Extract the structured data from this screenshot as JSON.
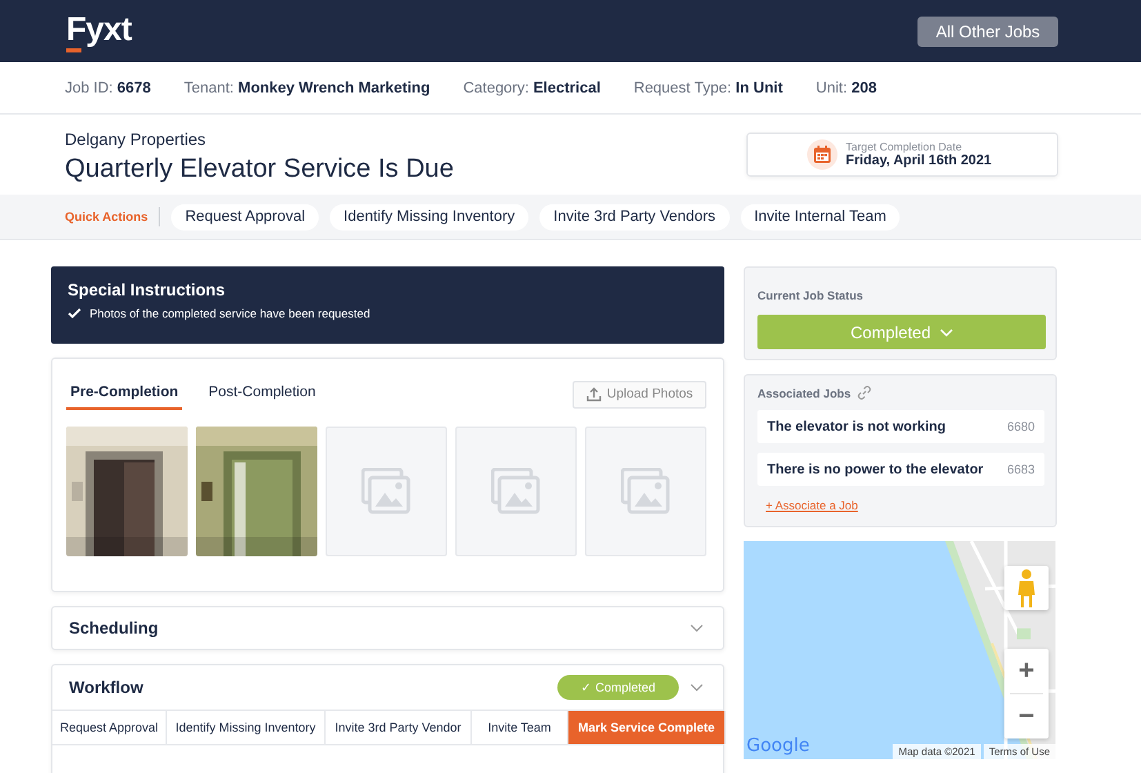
{
  "header": {
    "logo": "Fyxt",
    "button": "All Other Jobs"
  },
  "job_info": [
    {
      "label": "Job ID:",
      "value": "6678"
    },
    {
      "label": "Tenant:",
      "value": "Monkey Wrench Marketing"
    },
    {
      "label": "Category:",
      "value": "Electrical"
    },
    {
      "label": "Request Type:",
      "value": "In Unit"
    },
    {
      "label": "Unit:",
      "value": "208"
    }
  ],
  "property": "Delgany Properties",
  "title": "Quarterly Elevator Service Is Due",
  "target_date": {
    "label": "Target Completion Date",
    "value": "Friday, April 16th 2021"
  },
  "quick_actions": {
    "label": "Quick Actions",
    "items": [
      "Request Approval",
      "Identify Missing Inventory",
      "Invite 3rd Party Vendors",
      "Invite Internal Team"
    ]
  },
  "special_instructions": {
    "title": "Special Instructions",
    "items": [
      "Photos of the completed service have been requested"
    ]
  },
  "photos": {
    "tabs": [
      {
        "label": "Pre-Completion",
        "selected": true
      },
      {
        "label": "Post-Completion",
        "selected": false
      }
    ],
    "upload": "Upload Photos",
    "items": [
      {
        "kind": "picture"
      },
      {
        "kind": "picture"
      },
      {
        "kind": "placeholder"
      },
      {
        "kind": "placeholder"
      },
      {
        "kind": "placeholder"
      }
    ]
  },
  "sections": [
    {
      "title": "Scheduling",
      "expanded": false
    }
  ],
  "workflow": {
    "title": "Workflow",
    "status": "✓ Completed",
    "steps": [
      {
        "label": "Request Approval",
        "selected": false
      },
      {
        "label": "Identify Missing Inventory",
        "selected": false
      },
      {
        "label": "Invite 3rd Party Vendor",
        "selected": false
      },
      {
        "label": "Invite Team",
        "selected": false
      },
      {
        "label": "Mark Service Complete",
        "selected": true
      }
    ]
  },
  "job_status": {
    "label": "Current Job Status",
    "value": "Completed"
  },
  "associated_jobs": {
    "title": "Associated Jobs",
    "items": [
      {
        "name": "The elevator is not working",
        "id": "6680"
      },
      {
        "name": "There is no power to the elevator",
        "id": "6683"
      }
    ],
    "link": "+ Associate a Job"
  },
  "map": {
    "zoom_in": "+",
    "zoom_out": "−",
    "logo": "Google",
    "data": "Map data ©2021",
    "terms": "Terms of Use"
  }
}
